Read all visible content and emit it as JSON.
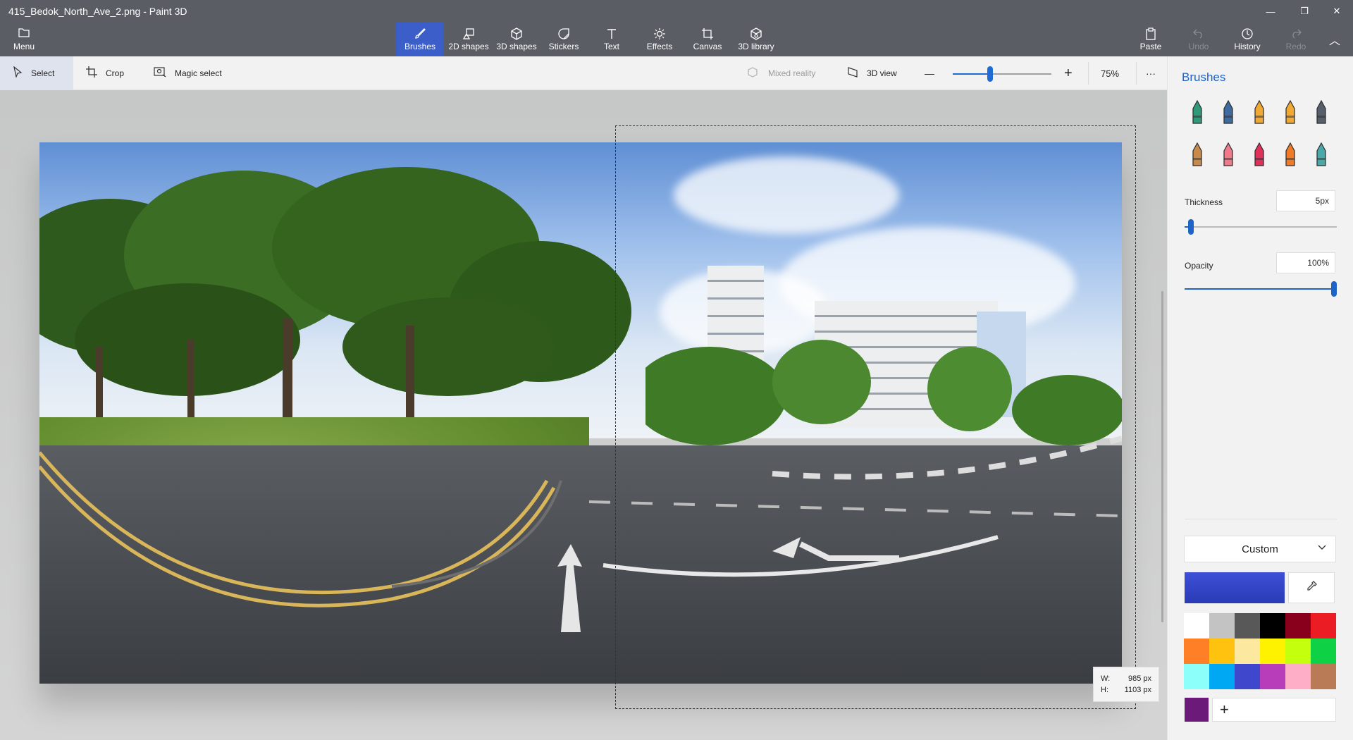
{
  "window": {
    "title": "415_Bedok_North_Ave_2.png - Paint 3D",
    "minimize_glyph": "—",
    "restore_glyph": "❐",
    "close_glyph": "✕"
  },
  "ribbon": {
    "menu": {
      "label": "Menu",
      "icon": "folder-icon"
    },
    "tabs": [
      {
        "label": "Brushes",
        "icon": "brush-icon",
        "active": true
      },
      {
        "label": "2D shapes",
        "icon": "2d-shapes-icon"
      },
      {
        "label": "3D shapes",
        "icon": "cube-icon"
      },
      {
        "label": "Stickers",
        "icon": "sticker-icon"
      },
      {
        "label": "Text",
        "icon": "text-icon"
      },
      {
        "label": "Effects",
        "icon": "sun-icon"
      },
      {
        "label": "Canvas",
        "icon": "canvas-icon"
      },
      {
        "label": "3D library",
        "icon": "3d-library-icon"
      }
    ],
    "right": [
      {
        "label": "Paste",
        "icon": "clipboard-icon",
        "enabled": true
      },
      {
        "label": "Undo",
        "icon": "undo-icon",
        "enabled": false
      },
      {
        "label": "History",
        "icon": "history-icon",
        "enabled": true
      },
      {
        "label": "Redo",
        "icon": "redo-icon",
        "enabled": false
      }
    ],
    "collapse_glyph": "︿"
  },
  "toolbar": {
    "select": "Select",
    "crop": "Crop",
    "magic_select": "Magic select",
    "mixed_reality": "Mixed reality",
    "view_3d": "3D view",
    "zoom_minus": "—",
    "zoom_plus": "+",
    "zoom_level": 75,
    "zoom_label": "75%",
    "more": "···"
  },
  "canvas": {
    "width_label": "W:",
    "width_value": "985 px",
    "height_label": "H:",
    "height_value": "1103 px"
  },
  "panel": {
    "title": "Brushes",
    "brush_icons": [
      {
        "name": "marker-brush-icon",
        "color": "#2f9a7a"
      },
      {
        "name": "calligraphy-pen-icon",
        "color": "#3f6aa0"
      },
      {
        "name": "oil-brush-icon",
        "color": "#f0a935"
      },
      {
        "name": "watercolor-brush-icon",
        "color": "#f0a935"
      },
      {
        "name": "pixel-pen-icon",
        "color": "#56606c"
      },
      {
        "name": "pencil-icon",
        "color": "#c88a4a"
      },
      {
        "name": "eraser-icon",
        "color": "#f07a8a"
      },
      {
        "name": "crayon-icon",
        "color": "#e0305a"
      },
      {
        "name": "spray-can-icon",
        "color": "#f07a25"
      },
      {
        "name": "fill-bucket-icon",
        "color": "#4aa8a8"
      }
    ],
    "thickness_label": "Thickness",
    "thickness_value": "5px",
    "thickness_level": 0.04,
    "opacity_label": "Opacity",
    "opacity_value": "100%",
    "opacity_level": 1.0,
    "color_mode": "Custom",
    "selected_color": "#3d4fd6",
    "palette": [
      "#ffffff",
      "#c3c3c3",
      "#585858",
      "#000000",
      "#88001b",
      "#ec1c24",
      "#ff7f27",
      "#ffc20e",
      "#fde89f",
      "#fff200",
      "#c4ff0e",
      "#0ed145",
      "#8cfffb",
      "#00a8f3",
      "#3f48cc",
      "#b83dba",
      "#ffaec8",
      "#b97a56"
    ],
    "custom_color": "#6b1a7a",
    "add_color_glyph": "+"
  },
  "accent": "#1e63c8"
}
